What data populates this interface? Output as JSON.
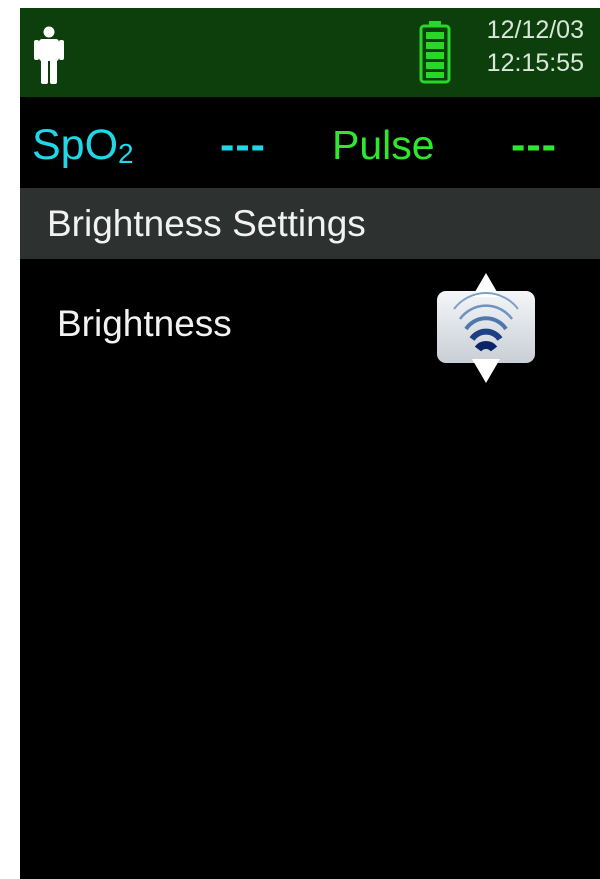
{
  "status_bar": {
    "date": "12/12/03",
    "time": "12:15:55",
    "patient_icon": "person-icon",
    "battery_icon": "battery-icon",
    "battery_level": 1.0,
    "colors": {
      "background": "#0c3f0c",
      "battery": "#29d629"
    }
  },
  "vitals": {
    "spo2_label": "SpO",
    "spo2_subscript": "2",
    "spo2_value": "---",
    "pulse_label": "Pulse",
    "pulse_value": "---",
    "colors": {
      "spo2": "#21d6e6",
      "pulse": "#2ee82e"
    }
  },
  "menu": {
    "title": "Brightness Settings",
    "items": [
      {
        "label": "Brightness",
        "control_icon": "brightness-adjust-icon"
      }
    ]
  }
}
